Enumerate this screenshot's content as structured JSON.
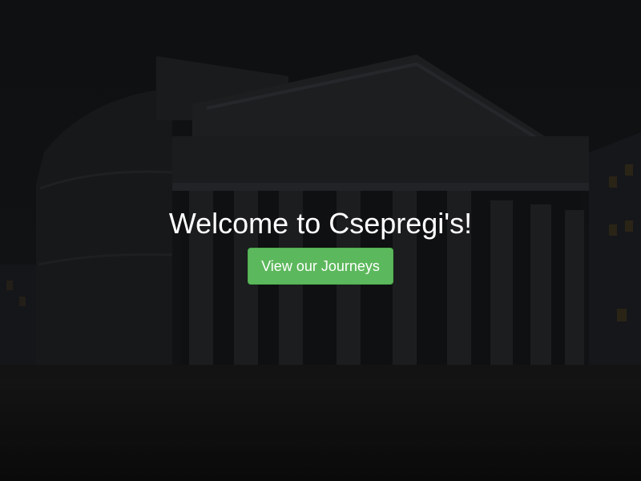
{
  "hero": {
    "title": "Welcome to Csepregi's!",
    "button_label": "View our Journeys",
    "background": "dimmed photo of the Pantheon at dusk"
  },
  "colors": {
    "button_bg": "#5cb85c",
    "button_border": "#4cae4c",
    "text": "#ffffff",
    "backdrop": "#0d0e0f"
  }
}
